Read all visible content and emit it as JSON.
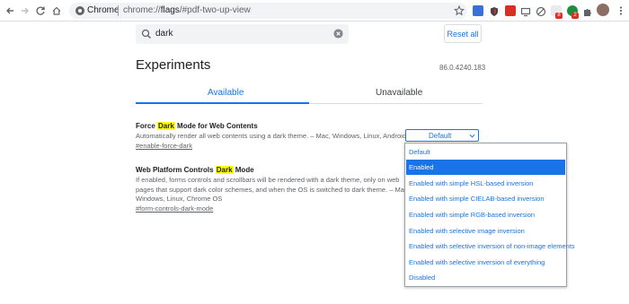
{
  "browser": {
    "site_label": "Chrome",
    "url_host": "chrome://",
    "url_strong": "flags",
    "url_rest": "/#pdf-two-up-view",
    "extension_badges": [
      "8",
      "2"
    ]
  },
  "search": {
    "value": "dark",
    "reset_label": "Reset all"
  },
  "header": {
    "title": "Experiments",
    "version": "86.0.4240.183"
  },
  "tabs": [
    {
      "label": "Available",
      "active": true
    },
    {
      "label": "Unavailable",
      "active": false
    }
  ],
  "experiments": [
    {
      "title_before": "Force ",
      "title_highlight": "Dark",
      "title_after": " Mode for Web Contents",
      "description": "Automatically render all web contents using a dark theme. – Mac, Windows, Linux, Android",
      "link": "#enable-force-dark",
      "select_value": "Default"
    },
    {
      "title_before": "Web Platform Controls ",
      "title_highlight": "Dark",
      "title_after": " Mode",
      "description_lines": [
        "If enabled, forms controls and scrollbars will be rendered with a dark theme, only on web",
        "pages that support dark color schemes, and when the OS is switched to dark theme. – Mac,",
        "Windows, Linux, Chrome OS"
      ],
      "link": "#form-controls-dark-mode"
    }
  ],
  "dropdown_options": [
    "Default",
    "Enabled",
    "Enabled with simple HSL-based inversion",
    "Enabled with simple CIELAB-based inversion",
    "Enabled with simple RGB-based inversion",
    "Enabled with selective image inversion",
    "Enabled with selective inversion of non-image elements",
    "Enabled with selective inversion of everything",
    "Disabled"
  ],
  "dropdown_selected_index": 1,
  "colors": {
    "accent": "#1a73e8",
    "highlight": "#ffff00",
    "badge": "#d93025"
  }
}
